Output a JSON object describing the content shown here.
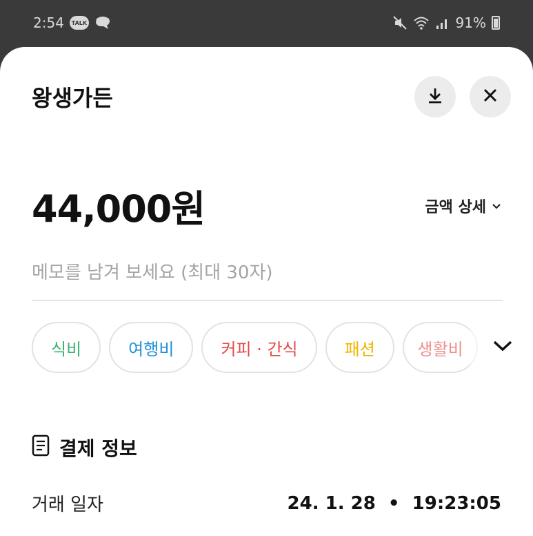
{
  "status_bar": {
    "time": "2:54",
    "talk_badge": "TALK",
    "battery": "91%"
  },
  "header": {
    "title": "왕생가든"
  },
  "amount": {
    "value": "44,000원",
    "detail_label": "금액 상세"
  },
  "memo": {
    "placeholder": "메모를 남겨 보세요 (최대 30자)"
  },
  "categories": [
    {
      "label": "식비",
      "color": "#3cb371"
    },
    {
      "label": "여행비",
      "color": "#1e90d6"
    },
    {
      "label": "커피 · 간식",
      "color": "#e24a4a"
    },
    {
      "label": "패션",
      "color": "#f0b400"
    },
    {
      "label": "생활비",
      "color": "#ef8f8f"
    }
  ],
  "payment_info": {
    "section_title": "결제 정보",
    "rows": [
      {
        "label": "거래 일자",
        "value": "24. 1. 28  •  19:23:05"
      }
    ]
  },
  "icons": {
    "download": "download-icon",
    "close": "close-icon",
    "chevron": "chevron-down-icon",
    "receipt": "receipt-icon"
  }
}
